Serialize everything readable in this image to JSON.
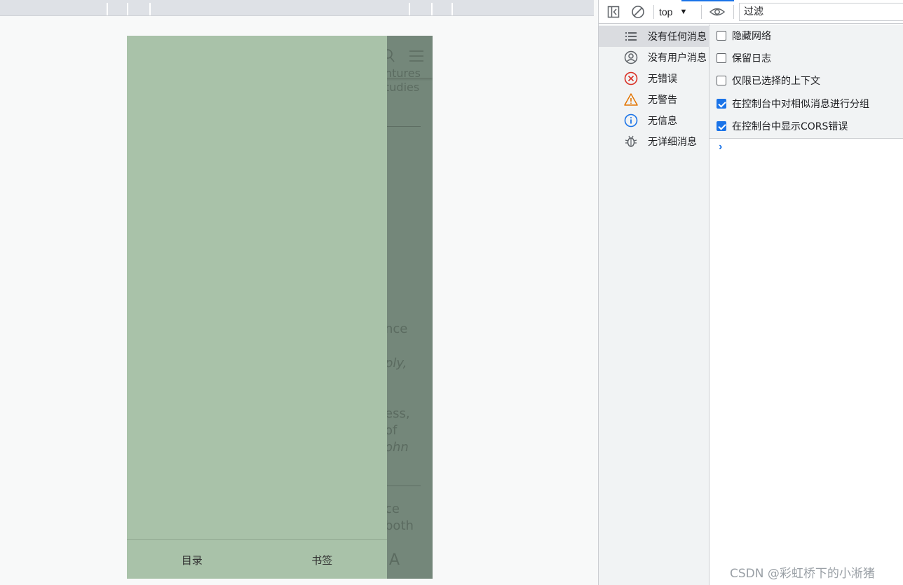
{
  "page": {
    "background_text": [
      "ntures",
      "tudies",
      "nce",
      "ply,",
      "ess,",
      "of",
      "ohn",
      "ce",
      "both"
    ],
    "drawer": {
      "toc_label": "目录",
      "bookmark_label": "书签"
    },
    "font_button_label": "A",
    "colors": {
      "overlay": "#74877a",
      "drawer": "#a9c2a9"
    }
  },
  "devtools": {
    "toolbar": {
      "context": "top",
      "filter_placeholder": "过滤"
    },
    "sidebar": {
      "items": [
        {
          "label": "没有任何消息",
          "icon": "list-icon"
        },
        {
          "label": "没有用户消息",
          "icon": "user-icon"
        },
        {
          "label": "无错误",
          "icon": "error-icon"
        },
        {
          "label": "无警告",
          "icon": "warning-icon"
        },
        {
          "label": "无信息",
          "icon": "info-icon"
        },
        {
          "label": "无详细消息",
          "icon": "bug-icon"
        }
      ]
    },
    "settings": [
      {
        "label": "隐藏网络",
        "checked": false
      },
      {
        "label": "保留日志",
        "checked": false
      },
      {
        "label": "仅限已选择的上下文",
        "checked": false
      },
      {
        "label": "在控制台中对相似消息进行分组",
        "checked": true
      },
      {
        "label": "在控制台中显示CORS错误",
        "checked": true
      }
    ],
    "prompt_symbol": "›",
    "watermark": "CSDN @彩虹桥下的小淅猪"
  }
}
